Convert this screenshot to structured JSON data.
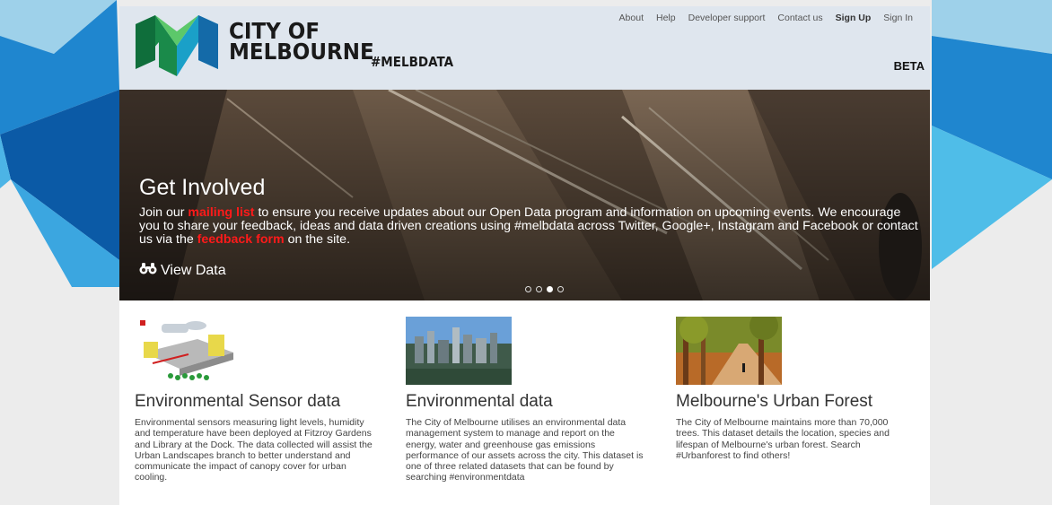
{
  "brand": {
    "line1": "CITY OF",
    "line2": "MELBOURNE",
    "tagline": "#MELBDATA",
    "badge": "BETA"
  },
  "topnav": {
    "items": [
      "About",
      "Help",
      "Developer support",
      "Contact us",
      "Sign Up",
      "Sign In"
    ]
  },
  "hero": {
    "title": "Get Involved",
    "text_part1": "Join our ",
    "link1": "mailing list",
    "text_part2": " to ensure you receive updates about our Open Data program and information on upcoming events. We encourage you to share your feedback, ideas and data driven creations using #melbdata across Twitter, Google+, Instagram and Facebook or contact us via the ",
    "link2": "feedback form",
    "text_part3": " on the site.",
    "cta": "View Data",
    "slide_count": 4,
    "active_slide": 3
  },
  "cards": [
    {
      "title": "Environmental Sensor data",
      "description": "Environmental sensors measuring light levels, humidity and temperature have been deployed at Fitzroy Gardens and Library at the Dock. The data collected will assist the Urban Landscapes branch to better understand and communicate the impact of canopy cover for urban cooling."
    },
    {
      "title": "Environmental data",
      "description": "The City of Melbourne utilises an environmental data management system to manage and report on the energy, water and greenhouse gas emissions performance of our assets across the city. This dataset is one of three related datasets that can be found by searching #environmentdata"
    },
    {
      "title": "Melbourne's Urban Forest",
      "description": "The City of Melbourne maintains more than 70,000 trees. This dataset details the location, species and lifespan of Melbourne's urban forest. Search #Urbanforest to find others!"
    }
  ],
  "colors": {
    "accent_blue": "#1e8bd6",
    "link_red": "#ff1a1a",
    "header_bg": "#dfe6ee"
  }
}
